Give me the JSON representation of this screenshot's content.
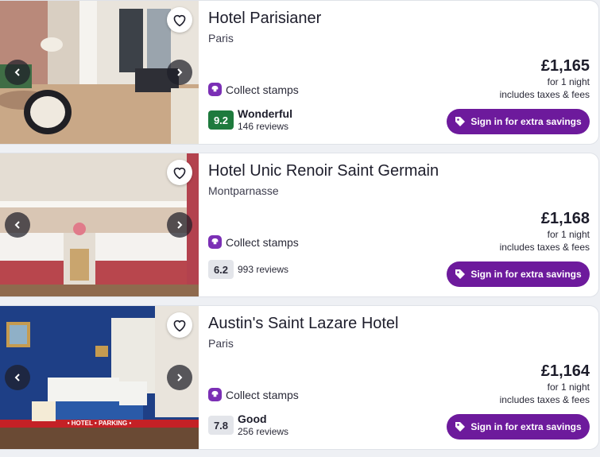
{
  "colors": {
    "brand_purple": "#6d1a9c",
    "stamp_purple": "#7b2fb5",
    "rating_green": "#1e7a3d",
    "rating_grey": "#e3e5ea"
  },
  "icons": {
    "favorite": "heart-outline",
    "prev": "chevron-left",
    "next": "chevron-right",
    "stamps": "stamp",
    "signin": "price-tag"
  },
  "hotels": [
    {
      "name": "Hotel Parisianer",
      "location": "Paris",
      "stamps_label": "Collect stamps",
      "rating": {
        "score": "9.2",
        "word": "Wonderful",
        "reviews": "146 reviews"
      },
      "price": {
        "amount": "£1,165",
        "per": "for 1 night",
        "taxes": "includes taxes & fees"
      },
      "signin_label": "Sign in for extra savings"
    },
    {
      "name": "Hotel Unic Renoir Saint Germain",
      "location": "Montparnasse",
      "stamps_label": "Collect stamps",
      "rating": {
        "score": "6.2",
        "word": "",
        "reviews": "993 reviews"
      },
      "price": {
        "amount": "£1,168",
        "per": "for 1 night",
        "taxes": "includes taxes & fees"
      },
      "signin_label": "Sign in for extra savings"
    },
    {
      "name": "Austin's Saint Lazare Hotel",
      "location": "Paris",
      "stamps_label": "Collect stamps",
      "rating": {
        "score": "7.8",
        "word": "Good",
        "reviews": "256 reviews"
      },
      "price": {
        "amount": "£1,164",
        "per": "for 1 night",
        "taxes": "includes taxes & fees"
      },
      "signin_label": "Sign in for extra savings",
      "photo_caption": "• HOTEL • PARKING •"
    }
  ]
}
